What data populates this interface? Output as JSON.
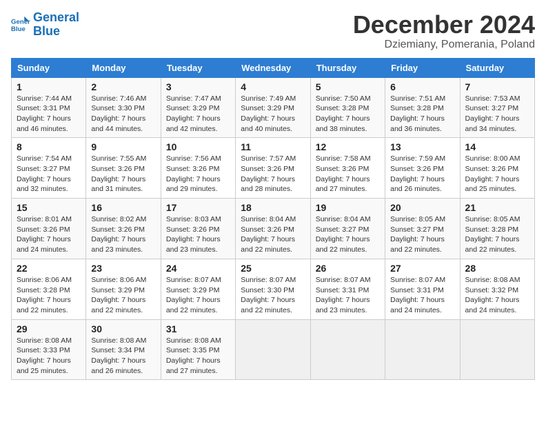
{
  "header": {
    "logo_line1": "General",
    "logo_line2": "Blue",
    "month": "December 2024",
    "location": "Dziemiany, Pomerania, Poland"
  },
  "weekdays": [
    "Sunday",
    "Monday",
    "Tuesday",
    "Wednesday",
    "Thursday",
    "Friday",
    "Saturday"
  ],
  "weeks": [
    [
      {
        "day": "1",
        "info": "Sunrise: 7:44 AM\nSunset: 3:31 PM\nDaylight: 7 hours\nand 46 minutes."
      },
      {
        "day": "2",
        "info": "Sunrise: 7:46 AM\nSunset: 3:30 PM\nDaylight: 7 hours\nand 44 minutes."
      },
      {
        "day": "3",
        "info": "Sunrise: 7:47 AM\nSunset: 3:29 PM\nDaylight: 7 hours\nand 42 minutes."
      },
      {
        "day": "4",
        "info": "Sunrise: 7:49 AM\nSunset: 3:29 PM\nDaylight: 7 hours\nand 40 minutes."
      },
      {
        "day": "5",
        "info": "Sunrise: 7:50 AM\nSunset: 3:28 PM\nDaylight: 7 hours\nand 38 minutes."
      },
      {
        "day": "6",
        "info": "Sunrise: 7:51 AM\nSunset: 3:28 PM\nDaylight: 7 hours\nand 36 minutes."
      },
      {
        "day": "7",
        "info": "Sunrise: 7:53 AM\nSunset: 3:27 PM\nDaylight: 7 hours\nand 34 minutes."
      }
    ],
    [
      {
        "day": "8",
        "info": "Sunrise: 7:54 AM\nSunset: 3:27 PM\nDaylight: 7 hours\nand 32 minutes."
      },
      {
        "day": "9",
        "info": "Sunrise: 7:55 AM\nSunset: 3:26 PM\nDaylight: 7 hours\nand 31 minutes."
      },
      {
        "day": "10",
        "info": "Sunrise: 7:56 AM\nSunset: 3:26 PM\nDaylight: 7 hours\nand 29 minutes."
      },
      {
        "day": "11",
        "info": "Sunrise: 7:57 AM\nSunset: 3:26 PM\nDaylight: 7 hours\nand 28 minutes."
      },
      {
        "day": "12",
        "info": "Sunrise: 7:58 AM\nSunset: 3:26 PM\nDaylight: 7 hours\nand 27 minutes."
      },
      {
        "day": "13",
        "info": "Sunrise: 7:59 AM\nSunset: 3:26 PM\nDaylight: 7 hours\nand 26 minutes."
      },
      {
        "day": "14",
        "info": "Sunrise: 8:00 AM\nSunset: 3:26 PM\nDaylight: 7 hours\nand 25 minutes."
      }
    ],
    [
      {
        "day": "15",
        "info": "Sunrise: 8:01 AM\nSunset: 3:26 PM\nDaylight: 7 hours\nand 24 minutes."
      },
      {
        "day": "16",
        "info": "Sunrise: 8:02 AM\nSunset: 3:26 PM\nDaylight: 7 hours\nand 23 minutes."
      },
      {
        "day": "17",
        "info": "Sunrise: 8:03 AM\nSunset: 3:26 PM\nDaylight: 7 hours\nand 23 minutes."
      },
      {
        "day": "18",
        "info": "Sunrise: 8:04 AM\nSunset: 3:26 PM\nDaylight: 7 hours\nand 22 minutes."
      },
      {
        "day": "19",
        "info": "Sunrise: 8:04 AM\nSunset: 3:27 PM\nDaylight: 7 hours\nand 22 minutes."
      },
      {
        "day": "20",
        "info": "Sunrise: 8:05 AM\nSunset: 3:27 PM\nDaylight: 7 hours\nand 22 minutes."
      },
      {
        "day": "21",
        "info": "Sunrise: 8:05 AM\nSunset: 3:28 PM\nDaylight: 7 hours\nand 22 minutes."
      }
    ],
    [
      {
        "day": "22",
        "info": "Sunrise: 8:06 AM\nSunset: 3:28 PM\nDaylight: 7 hours\nand 22 minutes."
      },
      {
        "day": "23",
        "info": "Sunrise: 8:06 AM\nSunset: 3:29 PM\nDaylight: 7 hours\nand 22 minutes."
      },
      {
        "day": "24",
        "info": "Sunrise: 8:07 AM\nSunset: 3:29 PM\nDaylight: 7 hours\nand 22 minutes."
      },
      {
        "day": "25",
        "info": "Sunrise: 8:07 AM\nSunset: 3:30 PM\nDaylight: 7 hours\nand 22 minutes."
      },
      {
        "day": "26",
        "info": "Sunrise: 8:07 AM\nSunset: 3:31 PM\nDaylight: 7 hours\nand 23 minutes."
      },
      {
        "day": "27",
        "info": "Sunrise: 8:07 AM\nSunset: 3:31 PM\nDaylight: 7 hours\nand 24 minutes."
      },
      {
        "day": "28",
        "info": "Sunrise: 8:08 AM\nSunset: 3:32 PM\nDaylight: 7 hours\nand 24 minutes."
      }
    ],
    [
      {
        "day": "29",
        "info": "Sunrise: 8:08 AM\nSunset: 3:33 PM\nDaylight: 7 hours\nand 25 minutes."
      },
      {
        "day": "30",
        "info": "Sunrise: 8:08 AM\nSunset: 3:34 PM\nDaylight: 7 hours\nand 26 minutes."
      },
      {
        "day": "31",
        "info": "Sunrise: 8:08 AM\nSunset: 3:35 PM\nDaylight: 7 hours\nand 27 minutes."
      },
      null,
      null,
      null,
      null
    ]
  ]
}
